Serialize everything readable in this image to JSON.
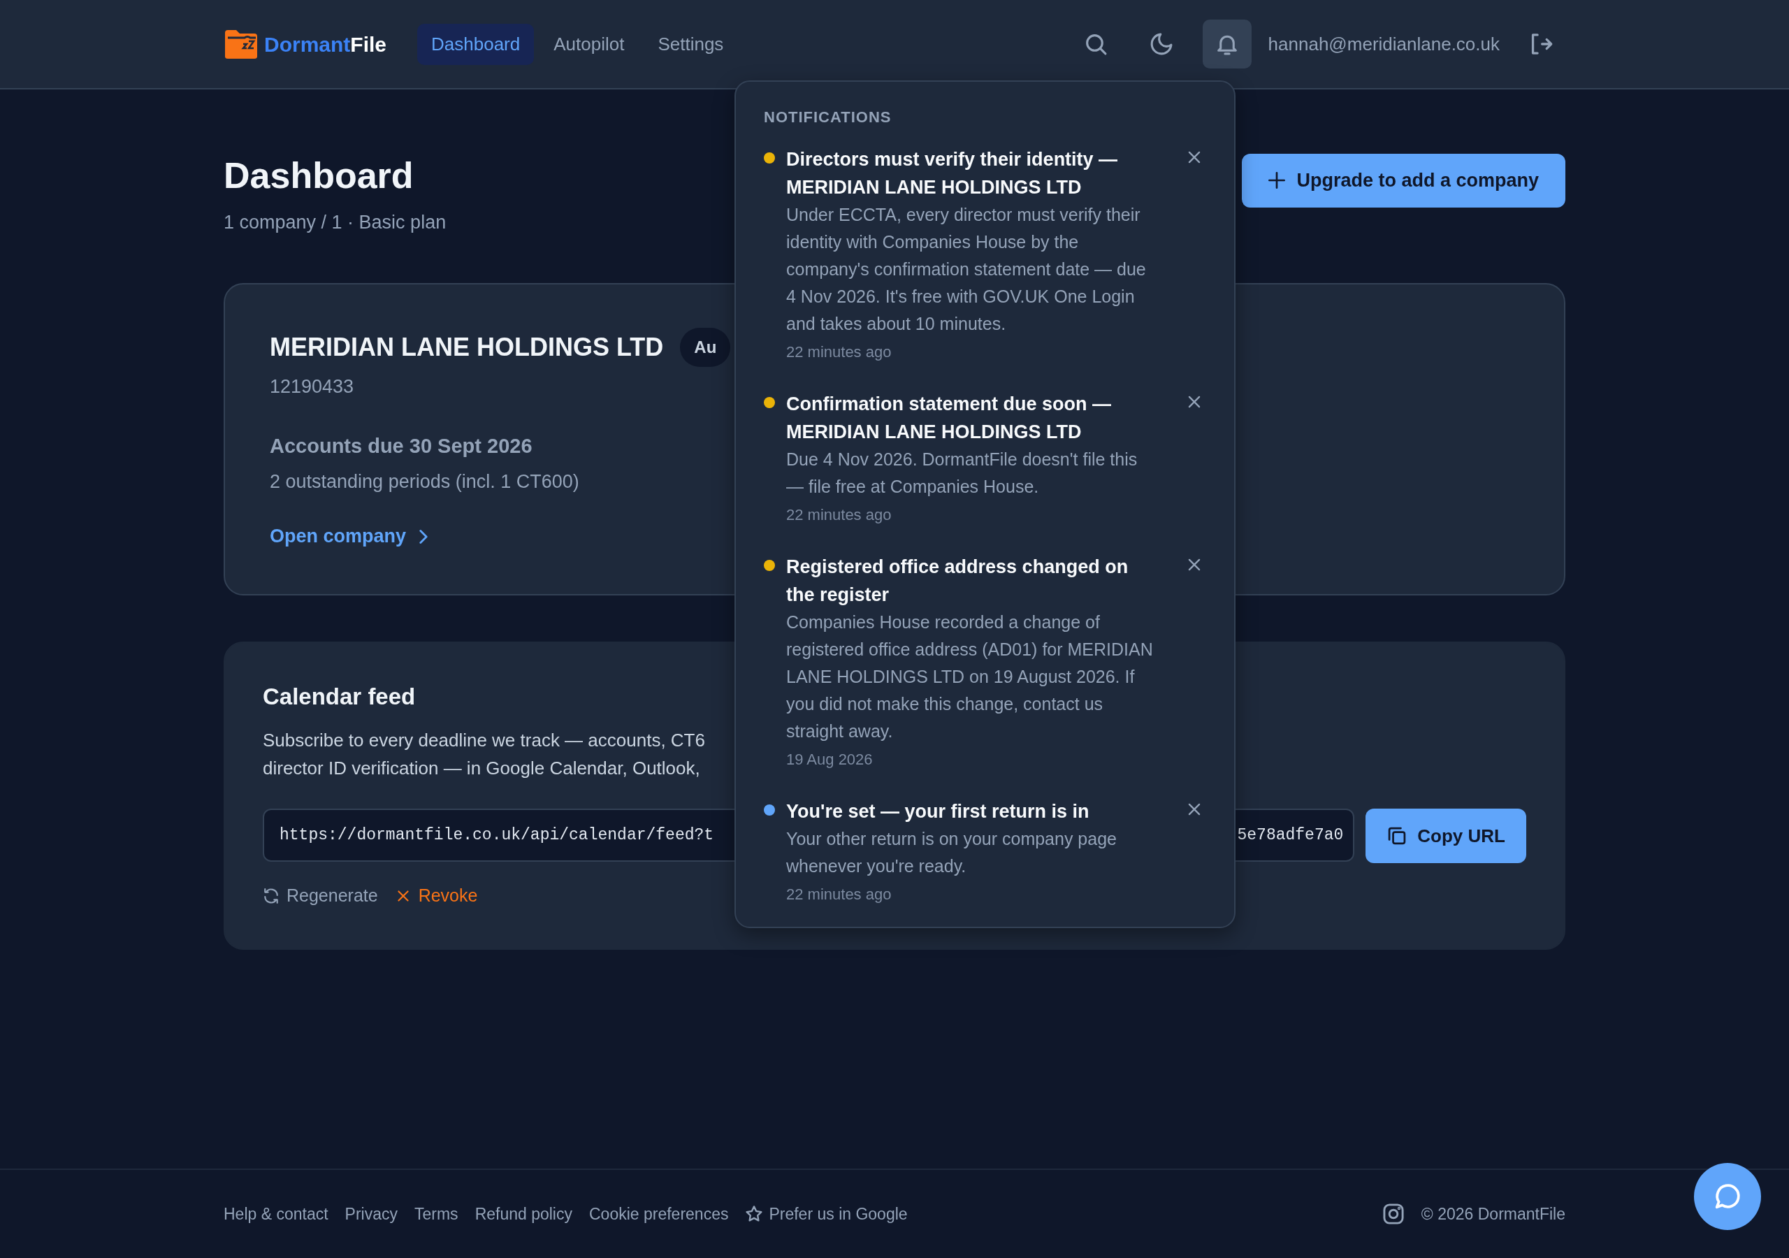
{
  "brand": {
    "name_part_1": "Dormant",
    "name_part_2": "File"
  },
  "nav": [
    {
      "label": "Dashboard",
      "selected": true
    },
    {
      "label": "Autopilot",
      "selected": false
    },
    {
      "label": "Settings",
      "selected": false
    }
  ],
  "header": {
    "notifications_open": true,
    "user_email": "hannah@meridianlane.co.uk"
  },
  "page": {
    "title": "Dashboard",
    "subtitle": "1 company / 1 · Basic plan",
    "upgrade_button": "Upgrade to add a company"
  },
  "companies": [
    {
      "name": "MERIDIAN LANE HOLDINGS LTD",
      "badge": "Au",
      "number": "12190433",
      "accounts_due": "Accounts due 30 Sept 2026",
      "outstanding": "2 outstanding periods (incl. 1 CT600)",
      "link": "Open company"
    }
  ],
  "calendar_feed": {
    "title": "Calendar feed",
    "description_lines": [
      "Subscribe to every deadline we track — accounts, CT6",
      "director ID verification — in Google Calendar, Outlook,"
    ],
    "url_start": "https://dormantfile.co.uk/api/calendar/feed?t",
    "url_end": "5e78adfe7a0",
    "copy_button": "Copy URL",
    "actions": [
      {
        "label": "Regenerate",
        "kind": "neutral"
      },
      {
        "label": "Revoke",
        "kind": "danger"
      }
    ]
  },
  "notifications": {
    "heading": "NOTIFICATIONS",
    "items": [
      {
        "title": "Directors must verify their identity — MERIDIAN LANE HOLDINGS LTD",
        "body": "Under ECCTA, every director must verify their identity with Companies House by the company's confirmation statement date — due 4 Nov 2026. It's free with GOV.UK One Login and takes about 10 minutes.",
        "time": "22 minutes ago",
        "color": "#eab308"
      },
      {
        "title": "Confirmation statement due soon — MERIDIAN LANE HOLDINGS LTD",
        "body": "Due 4 Nov 2026. DormantFile doesn't file this — file free at Companies House.",
        "time": "22 minutes ago",
        "color": "#eab308"
      },
      {
        "title": "Registered office address changed on the register",
        "body": "Companies House recorded a change of registered office address (AD01) for MERIDIAN LANE HOLDINGS LTD on 19 August 2026. If you did not make this change, contact us straight away.",
        "time": "19 Aug 2026",
        "color": "#eab308"
      },
      {
        "title": "You're set — your first return is in",
        "body": "Your other return is on your company page whenever you're ready.",
        "time": "22 minutes ago",
        "color": "#60a5fa"
      }
    ]
  },
  "footer": {
    "links": [
      "Help & contact",
      "Privacy",
      "Terms",
      "Refund policy",
      "Cookie preferences"
    ],
    "featured_link": "Prefer us in Google",
    "copyright": "© 2026 DormantFile"
  }
}
